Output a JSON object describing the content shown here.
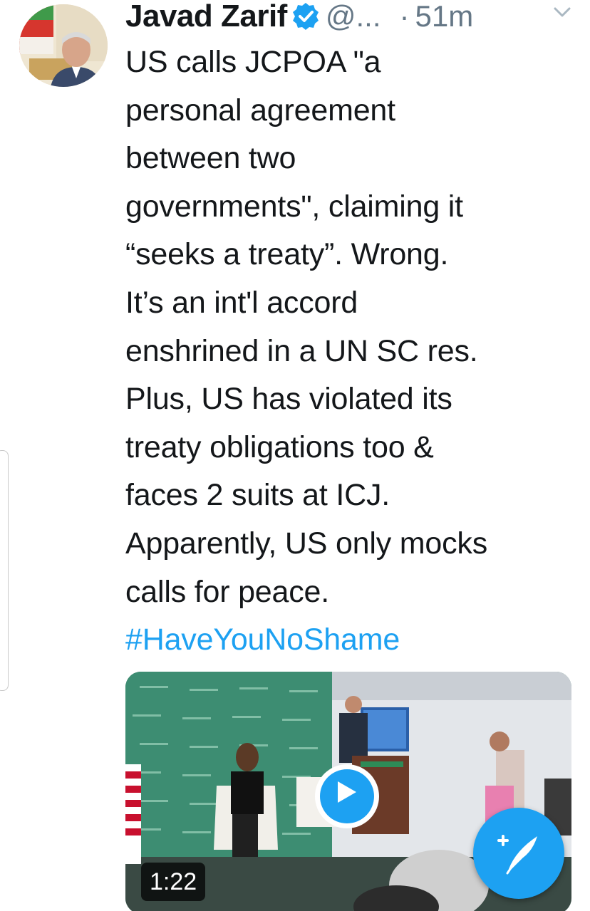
{
  "tweet": {
    "author_name": "Javad Zarif",
    "handle": "@...",
    "separator": "·",
    "time_ago": "51m",
    "text_lines": [
      "US calls JCPOA \"a",
      "personal agreement",
      "between two",
      "governments\", claiming it",
      "“seeks a treaty”. Wrong.",
      "It’s an int'l accord",
      "enshrined in a UN SC res.",
      "Plus, US has violated its",
      "treaty obligations too &",
      "faces 2 suits at ICJ.",
      "Apparently, US only mocks",
      "calls for peace."
    ],
    "hashtag": "#HaveYouNoShame"
  },
  "media": {
    "type": "video",
    "duration": "1:22",
    "play_icon": "play-icon"
  },
  "icons": {
    "verified": "verified-badge-icon",
    "caret": "chevron-down-icon",
    "compose": "compose-tweet-icon"
  },
  "colors": {
    "accent": "#1da1f2",
    "text": "#14171a",
    "secondary_text": "#657786"
  }
}
